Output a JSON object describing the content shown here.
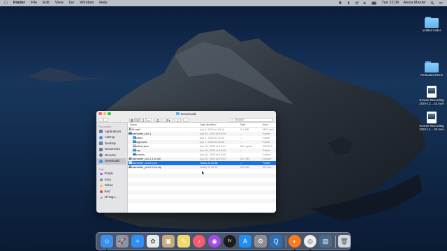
{
  "menubar": {
    "apple_icon": "apple-logo",
    "app_name": "Finder",
    "menus": [
      "File",
      "Edit",
      "View",
      "Go",
      "Window",
      "Help"
    ],
    "clock": "Tue 22:36",
    "user": "Alexa Master"
  },
  "desktop": {
    "items": [
      {
        "label": "untitled folder",
        "icon": "folder-icon"
      },
      {
        "label": "Relocated Items",
        "icon": "folder-icon"
      },
      {
        "label": "Screen Recording 2020-12....43.mov",
        "icon": "movie-file-icon"
      },
      {
        "label": "Screen Recording 2020-12....05.mov",
        "icon": "movie-file-icon"
      }
    ]
  },
  "finder": {
    "title": "Downloads",
    "search_placeholder": "Search",
    "sidebar": {
      "favorites_header": "Favourites",
      "favorites": [
        {
          "label": "Applications",
          "color": "#6b7c93"
        },
        {
          "label": "AirDrop",
          "color": "#3d8ef0"
        },
        {
          "label": "Desktop",
          "color": "#6b7c93"
        },
        {
          "label": "Documents",
          "color": "#6b7c93"
        },
        {
          "label": "Recents",
          "color": "#6b7c93"
        },
        {
          "label": "Downloads",
          "color": "#3d8ef0"
        }
      ],
      "tags_header": "Tags",
      "tags": [
        {
          "label": "Purple",
          "color": "#a75ad6"
        },
        {
          "label": "Grey",
          "color": "#8e8e93"
        },
        {
          "label": "Yellow",
          "color": "#f5c400"
        },
        {
          "label": "Red",
          "color": "#f0463c"
        },
        {
          "label": "All Tags...",
          "color": "#d7d7d7"
        }
      ]
    },
    "columns": {
      "name": "Name",
      "date": "Date Modified",
      "size": "Size",
      "kind": "Kind"
    },
    "rows": [
      {
        "name": "2344.mp3",
        "date": "Apr 9, 2020 at 19:14",
        "size": "5.1 MB",
        "kind": "MP3 aud",
        "type": "file",
        "disclosure": "",
        "indent": 0
      },
      {
        "name": "alexamaster_pro-1",
        "date": "Apr 16, 2020 at 16:00",
        "size": "--",
        "kind": "Folder",
        "type": "folder",
        "disclosure": "▼",
        "indent": 0
      },
      {
        "name": "_locales",
        "date": "Apr 2, 2020 at 14:14",
        "size": "--",
        "kind": "Folder",
        "type": "folder",
        "disclosure": "▶",
        "indent": 1
      },
      {
        "name": "background",
        "date": "Apr 7, 2020 at 22:31",
        "size": "--",
        "kind": "Folder",
        "type": "folder",
        "disclosure": "▶",
        "indent": 1
      },
      {
        "name": "manifest.json",
        "date": "Apr 16, 2020 at 13:01",
        "size": "861 bytes",
        "kind": "JSON D",
        "type": "file",
        "disclosure": "",
        "indent": 1
      },
      {
        "name": "popup",
        "date": "Apr 16, 2020 at 16:00",
        "size": "--",
        "kind": "Folder",
        "type": "folder",
        "disclosure": "▶",
        "indent": 1
      },
      {
        "name": "resources",
        "date": "Apr 16, 2020 at 16:00",
        "size": "--",
        "kind": "Folder",
        "type": "folder",
        "disclosure": "▶",
        "indent": 1
      },
      {
        "name": "alexamaster_pro-1.1-fx.xpi",
        "date": "Apr 16, 2020 at 15:53",
        "size": "222 KB",
        "kind": "Docum",
        "type": "file",
        "disclosure": "",
        "indent": 0
      },
      {
        "name": "alexamaster_pro-2.0-ch",
        "date": "Today at 22:36",
        "size": "--",
        "kind": "Folder",
        "type": "folder",
        "disclosure": "▶",
        "indent": 0,
        "selected": true
      },
      {
        "name": "alexamaster_pro-2.0-ch.zip",
        "date": "Today at 22:34",
        "size": "211 KB",
        "kind": "ZIP arc",
        "type": "file",
        "disclosure": "",
        "indent": 0
      }
    ]
  },
  "dock": {
    "apps": [
      {
        "name": "finder-icon",
        "color": "#3b8ff0"
      },
      {
        "name": "launchpad-icon",
        "color": "#8a94a6"
      },
      {
        "name": "safari-icon",
        "color": "#2f8ff5"
      },
      {
        "name": "photos-icon",
        "color": "#e9e9e9"
      },
      {
        "name": "preview-icon",
        "color": "#c9a97a"
      },
      {
        "name": "notes-icon",
        "color": "#f3d86b"
      },
      {
        "name": "music-icon",
        "color": "#fb5a6e"
      },
      {
        "name": "podcasts-icon",
        "color": "#a54ce2"
      },
      {
        "name": "apple-tv-icon",
        "color": "#1c1c1e"
      },
      {
        "name": "app-store-icon",
        "color": "#1d8ff2"
      },
      {
        "name": "system-preferences-icon",
        "color": "#8e8e93"
      },
      {
        "name": "quicktime-icon",
        "color": "#2b6fb8"
      },
      {
        "name": "firefox-icon",
        "color": "#ff7a1a"
      },
      {
        "name": "chrome-icon",
        "color": "#eeeeee"
      },
      {
        "name": "image-capture-icon",
        "color": "#4a6a8c"
      },
      {
        "name": "trash-icon",
        "color": "#cfd6de"
      }
    ]
  }
}
